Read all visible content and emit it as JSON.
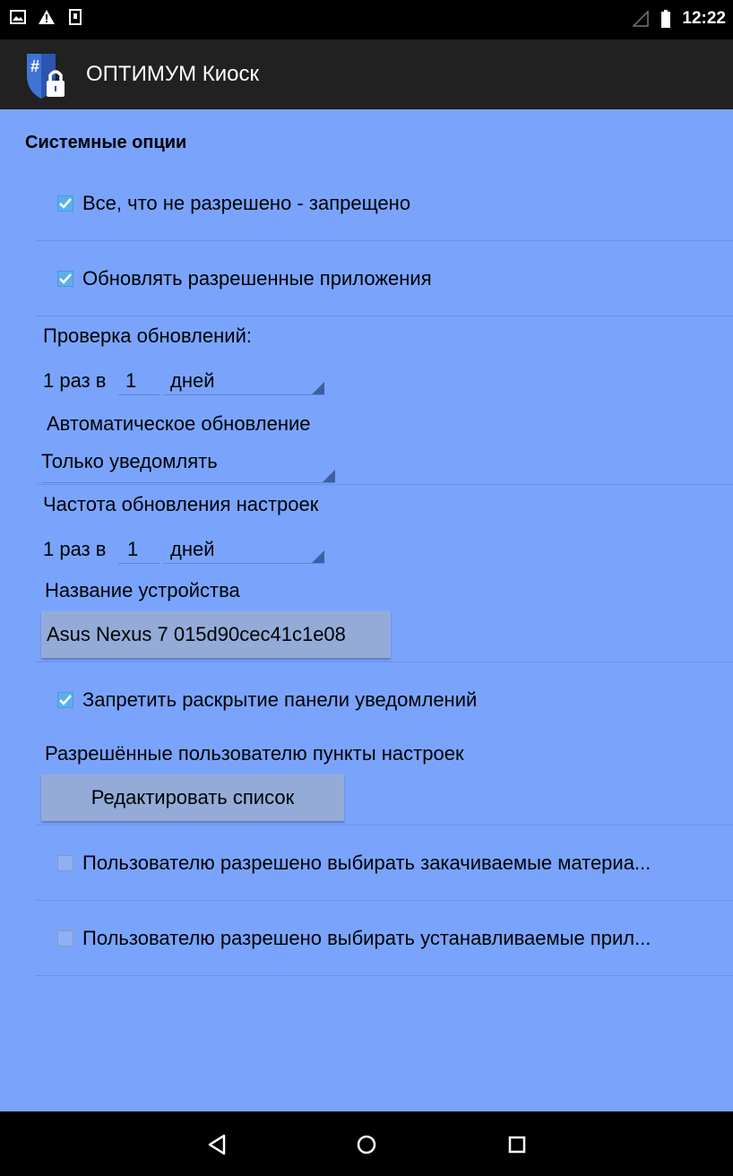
{
  "status_bar": {
    "icons_left": [
      "image-notification-icon",
      "warning-icon",
      "download-icon"
    ],
    "icons_right": [
      "signal-icon",
      "battery-icon"
    ],
    "time": "12:22"
  },
  "action_bar": {
    "title": "ОПТИМУМ Киоск",
    "logo": "shield-lock-icon"
  },
  "content": {
    "section_title": "Системные опции",
    "checkbox_deny_all": {
      "label": "Все, что не разрешено - запрещено",
      "checked": true
    },
    "checkbox_update_apps": {
      "label": "Обновлять разрешенные приложения",
      "checked": true
    },
    "update_check": {
      "label": "Проверка обновлений:",
      "prefix": "1 раз в",
      "value": "1",
      "unit": "дней"
    },
    "auto_update": {
      "label": "Автоматическое обновление",
      "selected": "Только уведомлять"
    },
    "settings_update_freq": {
      "label": "Частота обновления настроек",
      "prefix": "1 раз в",
      "value": "1",
      "unit": "дней"
    },
    "device_name": {
      "label": "Название устройства",
      "value": "Asus Nexus 7 015d90cec41c1e08"
    },
    "checkbox_block_notifications": {
      "label": "Запретить раскрытие панели уведомлений",
      "checked": true
    },
    "allowed_settings": {
      "label": "Разрешённые пользователю пункты настроек",
      "button": "Редактировать список"
    },
    "checkbox_downloads": {
      "label": "Пользователю разрешено выбирать закачиваемые материа...",
      "checked": false
    },
    "checkbox_install_apps": {
      "label": "Пользователю разрешено выбирать устанавливаемые прил...",
      "checked": false
    }
  },
  "nav_bar": {
    "icons": [
      "back-icon",
      "home-icon",
      "recents-icon"
    ]
  },
  "colors": {
    "content_bg": "#7aa4fc",
    "action_bar_bg": "#212121",
    "checkbox_checked": "#5ab0ec"
  }
}
